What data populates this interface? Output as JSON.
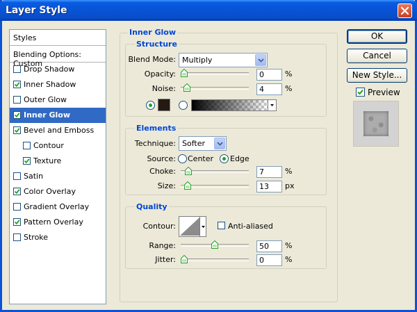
{
  "window": {
    "title": "Layer Style"
  },
  "styles_list": {
    "header": "Styles",
    "blending_options": "Blending Options: Custom",
    "items": [
      {
        "label": "Drop Shadow",
        "checked": false,
        "selected": false,
        "indent": false
      },
      {
        "label": "Inner Shadow",
        "checked": true,
        "selected": false,
        "indent": false
      },
      {
        "label": "Outer Glow",
        "checked": false,
        "selected": false,
        "indent": false
      },
      {
        "label": "Inner Glow",
        "checked": true,
        "selected": true,
        "indent": false
      },
      {
        "label": "Bevel and Emboss",
        "checked": true,
        "selected": false,
        "indent": false
      },
      {
        "label": "Contour",
        "checked": false,
        "selected": false,
        "indent": true
      },
      {
        "label": "Texture",
        "checked": true,
        "selected": false,
        "indent": true
      },
      {
        "label": "Satin",
        "checked": false,
        "selected": false,
        "indent": false
      },
      {
        "label": "Color Overlay",
        "checked": true,
        "selected": false,
        "indent": false
      },
      {
        "label": "Gradient Overlay",
        "checked": false,
        "selected": false,
        "indent": false
      },
      {
        "label": "Pattern Overlay",
        "checked": true,
        "selected": false,
        "indent": false
      },
      {
        "label": "Stroke",
        "checked": false,
        "selected": false,
        "indent": false
      }
    ]
  },
  "inner_glow": {
    "title": "Inner Glow",
    "structure": {
      "title": "Structure",
      "blend_mode_label": "Blend Mode:",
      "blend_mode_value": "Multiply",
      "opacity_label": "Opacity:",
      "opacity_value": "0",
      "opacity_unit": "%",
      "opacity_level": 0,
      "noise_label": "Noise:",
      "noise_value": "4",
      "noise_unit": "%",
      "noise_level": 4,
      "color_choice": "solid",
      "glow_color": "#241a12"
    },
    "elements": {
      "title": "Elements",
      "technique_label": "Technique:",
      "technique_value": "Softer",
      "source_label": "Source:",
      "source_center": "Center",
      "source_edge": "Edge",
      "source_selected": "Edge",
      "choke_label": "Choke:",
      "choke_value": "7",
      "choke_unit": "%",
      "choke_level": 7,
      "size_label": "Size:",
      "size_value": "13",
      "size_unit": "px",
      "size_level": 13
    },
    "quality": {
      "title": "Quality",
      "contour_label": "Contour:",
      "anti_aliased_label": "Anti-aliased",
      "anti_aliased": false,
      "range_label": "Range:",
      "range_value": "50",
      "range_unit": "%",
      "range_level": 50,
      "jitter_label": "Jitter:",
      "jitter_value": "0",
      "jitter_unit": "%",
      "jitter_level": 0
    }
  },
  "buttons": {
    "ok": "OK",
    "cancel": "Cancel",
    "new_style": "New Style..."
  },
  "preview": {
    "label": "Preview",
    "checked": true
  }
}
